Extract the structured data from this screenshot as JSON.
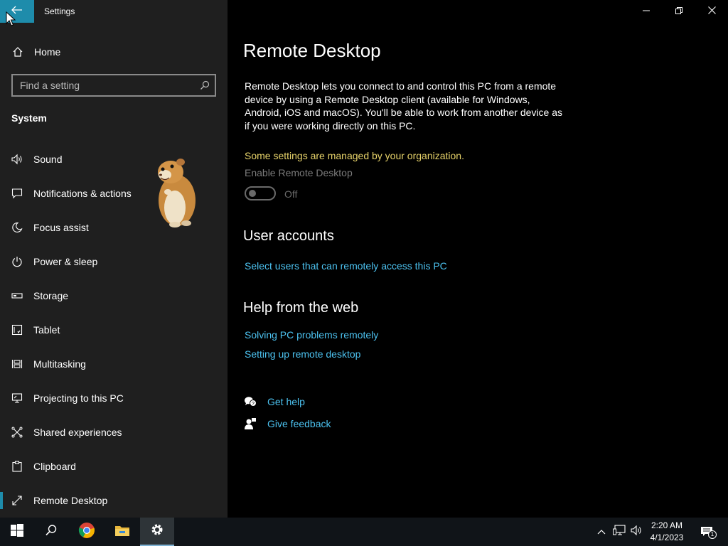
{
  "window": {
    "title": "Settings"
  },
  "sidebar": {
    "home_label": "Home",
    "search_placeholder": "Find a setting",
    "section_title": "System",
    "items": [
      {
        "label": "Sound",
        "icon": "speaker-icon"
      },
      {
        "label": "Notifications & actions",
        "icon": "notification-icon"
      },
      {
        "label": "Focus assist",
        "icon": "moon-icon"
      },
      {
        "label": "Power & sleep",
        "icon": "power-icon"
      },
      {
        "label": "Storage",
        "icon": "storage-icon"
      },
      {
        "label": "Tablet",
        "icon": "tablet-icon"
      },
      {
        "label": "Multitasking",
        "icon": "multitasking-icon"
      },
      {
        "label": "Projecting to this PC",
        "icon": "projecting-icon"
      },
      {
        "label": "Shared experiences",
        "icon": "shared-icon"
      },
      {
        "label": "Clipboard",
        "icon": "clipboard-icon"
      },
      {
        "label": "Remote Desktop",
        "icon": "remote-desktop-icon",
        "active": true
      }
    ]
  },
  "main": {
    "title": "Remote Desktop",
    "description": "Remote Desktop lets you connect to and control this PC from a remote device by using a Remote Desktop client (available for Windows, Android, iOS and macOS). You'll be able to work from another device as if you were working directly on this PC.",
    "managed_notice": "Some settings are managed by your organization.",
    "enable_label": "Enable Remote Desktop",
    "toggle_state": "Off",
    "user_accounts_heading": "User accounts",
    "select_users_link": "Select users that can remotely access this PC",
    "help_heading": "Help from the web",
    "help_links": [
      "Solving PC problems remotely",
      "Setting up remote desktop"
    ],
    "get_help": "Get help",
    "give_feedback": "Give feedback"
  },
  "taskbar": {
    "time": "2:20 AM",
    "date": "4/1/2023",
    "notification_count": "1"
  },
  "colors": {
    "accent": "#1e8cab",
    "link": "#4cc2f0",
    "warning": "#e7d36a",
    "sidebar_bg": "#1f1f1f"
  }
}
